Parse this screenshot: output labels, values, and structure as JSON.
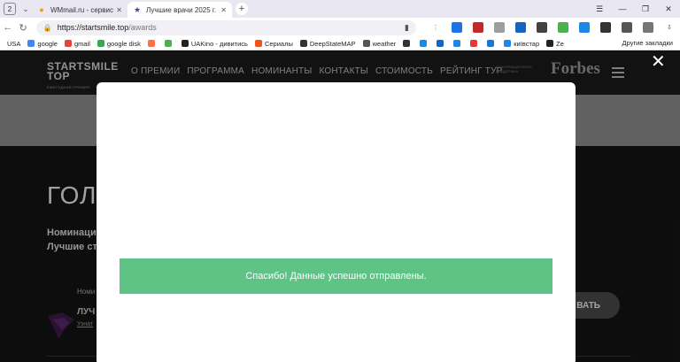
{
  "browser": {
    "tab_count": "2",
    "tabs": [
      {
        "title": "WMmail.ru - сервис почтового",
        "active": false
      },
      {
        "title": "Лучшие врачи 2025 г.",
        "active": true
      }
    ],
    "url_main": "https://startsmile.top",
    "url_path": "/awards",
    "bookmarks": [
      {
        "label": "USA",
        "color": "#ffffff"
      },
      {
        "label": "google",
        "color": "#4285f4"
      },
      {
        "label": "gmail",
        "color": "#ea4335"
      },
      {
        "label": "google disk",
        "color": "#34a853"
      },
      {
        "label": "",
        "color": "#ff7043"
      },
      {
        "label": "",
        "color": "#4caf50"
      },
      {
        "label": "UAKino - дивитись",
        "color": "#222222"
      },
      {
        "label": "Сериалы",
        "color": "#f4511e"
      },
      {
        "label": "DeepStateMAP",
        "color": "#333333"
      },
      {
        "label": "weather",
        "color": "#555555"
      },
      {
        "label": "",
        "color": "#333333"
      },
      {
        "label": "",
        "color": "#1e88e5"
      },
      {
        "label": "",
        "color": "#1565c0"
      },
      {
        "label": "",
        "color": "#1e88e5"
      },
      {
        "label": "",
        "color": "#e53935"
      },
      {
        "label": "",
        "color": "#1976d2"
      },
      {
        "label": "київстар",
        "color": "#1e88e5"
      },
      {
        "label": "Ze",
        "color": "#222222"
      }
    ],
    "other_bookmarks": "Другие закладки"
  },
  "site": {
    "logo_line1": "STARTSMILE",
    "logo_line2": "TOP",
    "logo_tagline": "ЕЖЕГОДНАЯ ПРЕМИЯ",
    "nav": [
      "О ПРЕМИИ",
      "ПРОГРАММА",
      "НОМИНАНТЫ",
      "КОНТАКТЫ",
      "СТОИМОСТЬ",
      "РЕЙТИНГ ТУР"
    ],
    "partner_label": "ИНФОРМАЦИОННОЕ ПОДДЕРЖКА",
    "partner_brand": "Forbes",
    "bg_title": "ГОЛ",
    "bg_sub1": "Номинаци",
    "bg_sub2": "Лучшие ст",
    "bg_nom": "Номи",
    "bg_name": "ЛУЧ",
    "bg_link": "Узнат",
    "bg_button": "ВАТЬ"
  },
  "modal": {
    "success_message": "Спасибо! Данные успешно отправлены."
  },
  "colors": {
    "success": "#5fc385",
    "page_bg": "#141414"
  }
}
